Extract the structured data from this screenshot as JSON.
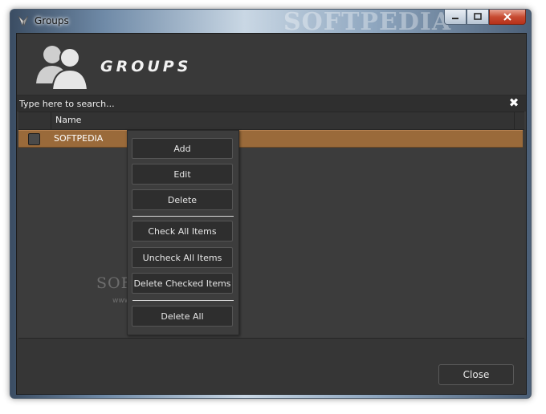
{
  "window": {
    "title": "Groups",
    "title_watermark": "SOFTPEDIA"
  },
  "header": {
    "title": "GROUPS",
    "icon": "users-icon"
  },
  "search": {
    "placeholder": "Type here to search...",
    "value": "",
    "clear_glyph": "✖"
  },
  "grid": {
    "columns": [
      "",
      "Name"
    ],
    "rows": [
      {
        "checked": false,
        "name": "SOFTPEDIA",
        "selected": true
      }
    ]
  },
  "context_menu": {
    "items": [
      "Add",
      "Edit",
      "Delete",
      "Check All Items",
      "Uncheck All Items",
      "Delete Checked Items",
      "Delete All"
    ]
  },
  "footer": {
    "close_label": "Close"
  },
  "watermark": {
    "text": "SOFTPEDIA",
    "url": "www.softpedia.com"
  },
  "colors": {
    "background": "#3a3a3a",
    "selected_row": "#9a6a3a",
    "text": "#e6e6e6"
  }
}
